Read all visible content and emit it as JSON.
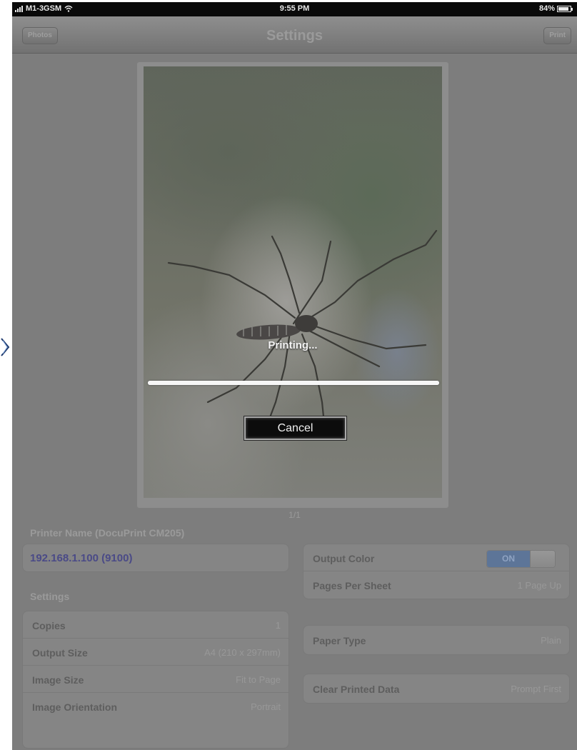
{
  "status_bar": {
    "carrier": "M1-3GSM",
    "time": "9:55 PM",
    "battery": "84%"
  },
  "nav": {
    "back_label": "Photos",
    "title": "Settings",
    "print_label": "Print"
  },
  "print_overlay": {
    "status_text": "Printing...",
    "progress": 1.0,
    "cancel_label": "Cancel"
  },
  "page_indicator": "1/1",
  "printer": {
    "section_label": "Printer Name (DocuPrint CM205)",
    "address": "192.168.1.100 (9100)"
  },
  "settings": {
    "section_label": "Settings",
    "rows": [
      {
        "label": "Copies",
        "value": "1"
      },
      {
        "label": "Output Size",
        "value": "A4 (210 x 297mm)"
      },
      {
        "label": "Image Size",
        "value": "Fit to Page"
      },
      {
        "label": "Image Orientation",
        "value": "Portrait"
      }
    ]
  },
  "color_group": {
    "output_color_label": "Output Color",
    "output_color_toggle": "ON",
    "pages_per_sheet_label": "Pages Per Sheet",
    "pages_per_sheet_value": "1 Page Up"
  },
  "paper": {
    "label": "Paper Type",
    "value": "Plain"
  },
  "clear": {
    "label": "Clear Printed Data",
    "value": "Prompt First"
  },
  "colors": {
    "overlay_dim": "#7d7d7d",
    "link_blue": "#4a4a87",
    "toggle_on": "#5d7598"
  }
}
